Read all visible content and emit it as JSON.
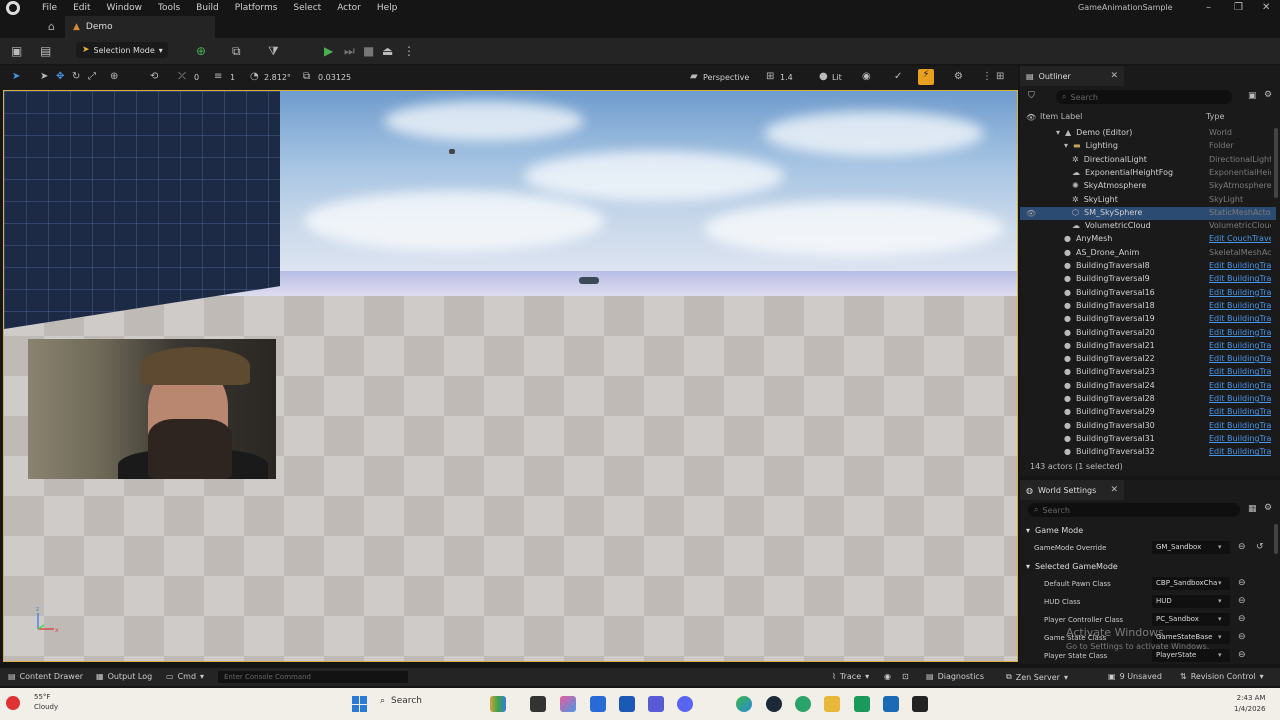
{
  "menu": [
    "File",
    "Edit",
    "Window",
    "Tools",
    "Build",
    "Platforms",
    "Select",
    "Actor",
    "Help"
  ],
  "app_title": "GameAnimationSample",
  "level_tab": "Demo",
  "toolbar": {
    "selection_mode": "Selection Mode"
  },
  "viewport_toolbar": {
    "snap_angle": "0",
    "grid_size": "1",
    "scale": "2.812°",
    "camera_speed": "0.03125",
    "view_mode": "Perspective",
    "fov": "1.4",
    "lighting": "Lit"
  },
  "outliner": {
    "title": "Outliner",
    "search_placeholder": "Search",
    "col_label": "Item Label",
    "col_type": "Type",
    "rows": [
      {
        "label": "Demo (Editor)",
        "type": "World",
        "indent": 2,
        "icon": "world-icon"
      },
      {
        "label": "Lighting",
        "type": "Folder",
        "indent": 3,
        "icon": "folder-icon"
      },
      {
        "label": "DirectionalLight",
        "type": "DirectionalLight",
        "indent": 4,
        "icon": "light-icon"
      },
      {
        "label": "ExponentialHeightFog",
        "type": "ExponentialHeig",
        "indent": 4,
        "icon": "fog-icon"
      },
      {
        "label": "SkyAtmosphere",
        "type": "SkyAtmosphere",
        "indent": 4,
        "icon": "sky-icon"
      },
      {
        "label": "SkyLight",
        "type": "SkyLight",
        "indent": 4,
        "icon": "light-icon"
      },
      {
        "label": "SM_SkySphere",
        "type": "StaticMeshActo",
        "indent": 4,
        "icon": "mesh-icon",
        "selected": true
      },
      {
        "label": "VolumetricCloud",
        "type": "VolumetricClouc",
        "indent": 4,
        "icon": "cloud-icon"
      },
      {
        "label": "AnyMesh",
        "type": "Edit CouchTrave",
        "indent": 3,
        "icon": "actor-icon",
        "link": true
      },
      {
        "label": "AS_Drone_Anim",
        "type": "SkeletalMeshAc",
        "indent": 3,
        "icon": "actor-icon"
      },
      {
        "label": "BuildingTraversal8",
        "type": "Edit BuildingTra",
        "indent": 3,
        "icon": "actor-icon",
        "link": true
      },
      {
        "label": "BuildingTraversal9",
        "type": "Edit BuildingTra",
        "indent": 3,
        "icon": "actor-icon",
        "link": true
      },
      {
        "label": "BuildingTraversal16",
        "type": "Edit BuildingTra",
        "indent": 3,
        "icon": "actor-icon",
        "link": true
      },
      {
        "label": "BuildingTraversal18",
        "type": "Edit BuildingTra",
        "indent": 3,
        "icon": "actor-icon",
        "link": true
      },
      {
        "label": "BuildingTraversal19",
        "type": "Edit BuildingTra",
        "indent": 3,
        "icon": "actor-icon",
        "link": true
      },
      {
        "label": "BuildingTraversal20",
        "type": "Edit BuildingTra",
        "indent": 3,
        "icon": "actor-icon",
        "link": true
      },
      {
        "label": "BuildingTraversal21",
        "type": "Edit BuildingTra",
        "indent": 3,
        "icon": "actor-icon",
        "link": true
      },
      {
        "label": "BuildingTraversal22",
        "type": "Edit BuildingTra",
        "indent": 3,
        "icon": "actor-icon",
        "link": true
      },
      {
        "label": "BuildingTraversal23",
        "type": "Edit BuildingTra",
        "indent": 3,
        "icon": "actor-icon",
        "link": true
      },
      {
        "label": "BuildingTraversal24",
        "type": "Edit BuildingTra",
        "indent": 3,
        "icon": "actor-icon",
        "link": true
      },
      {
        "label": "BuildingTraversal28",
        "type": "Edit BuildingTra",
        "indent": 3,
        "icon": "actor-icon",
        "link": true
      },
      {
        "label": "BuildingTraversal29",
        "type": "Edit BuildingTra",
        "indent": 3,
        "icon": "actor-icon",
        "link": true
      },
      {
        "label": "BuildingTraversal30",
        "type": "Edit BuildingTra",
        "indent": 3,
        "icon": "actor-icon",
        "link": true
      },
      {
        "label": "BuildingTraversal31",
        "type": "Edit BuildingTra",
        "indent": 3,
        "icon": "actor-icon",
        "link": true
      },
      {
        "label": "BuildingTraversal32",
        "type": "Edit BuildingTra",
        "indent": 3,
        "icon": "actor-icon",
        "link": true
      }
    ],
    "actor_count": "143 actors (1 selected)"
  },
  "world_settings": {
    "title": "World Settings",
    "search_placeholder": "Search",
    "section_game_mode": "Game Mode",
    "game_mode_override_label": "GameMode Override",
    "game_mode_override_value": "GM_Sandbox",
    "section_selected": "Selected GameMode",
    "fields": [
      {
        "label": "Default Pawn Class",
        "value": "CBP_SandboxCha"
      },
      {
        "label": "HUD Class",
        "value": "HUD"
      },
      {
        "label": "Player Controller Class",
        "value": "PC_Sandbox"
      },
      {
        "label": "Game State Class",
        "value": "GameStateBase"
      },
      {
        "label": "Player State Class",
        "value": "PlayerState"
      }
    ]
  },
  "watermark": {
    "line1": "Activate Windows",
    "line2": "Go to Settings to activate Windows."
  },
  "statusbar": {
    "content_drawer": "Content Drawer",
    "output_log": "Output Log",
    "cmd": "Cmd",
    "console_placeholder": "Enter Console Command",
    "trace": "Trace",
    "diagnostics": "Diagnostics",
    "zen_server": "Zen Server",
    "unsaved": "9 Unsaved",
    "revision_control": "Revision Control"
  },
  "taskbar": {
    "temperature": "55°F",
    "weather": "Cloudy",
    "search": "Search",
    "time": "2:43 AM",
    "date": "1/4/2026"
  },
  "colors": {
    "accent_selection": "#2c4b73",
    "viewport_border": "#d8b040",
    "link": "#4a96e8",
    "play": "#4caf50"
  }
}
